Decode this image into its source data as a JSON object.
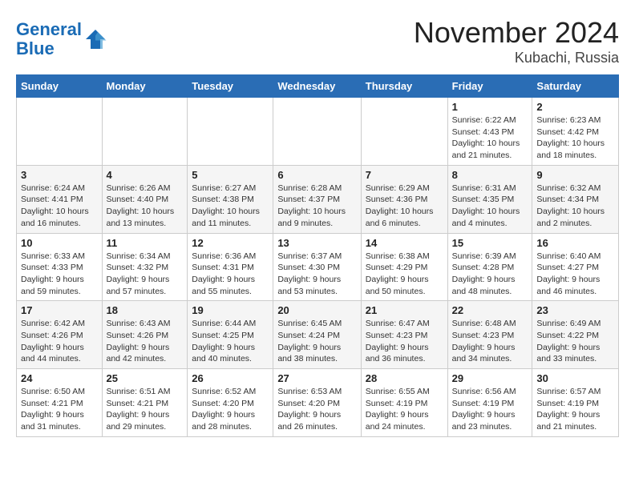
{
  "header": {
    "logo_line1": "General",
    "logo_line2": "Blue",
    "month": "November 2024",
    "location": "Kubachi, Russia"
  },
  "weekdays": [
    "Sunday",
    "Monday",
    "Tuesday",
    "Wednesday",
    "Thursday",
    "Friday",
    "Saturday"
  ],
  "weeks": [
    [
      {
        "day": "",
        "detail": ""
      },
      {
        "day": "",
        "detail": ""
      },
      {
        "day": "",
        "detail": ""
      },
      {
        "day": "",
        "detail": ""
      },
      {
        "day": "",
        "detail": ""
      },
      {
        "day": "1",
        "detail": "Sunrise: 6:22 AM\nSunset: 4:43 PM\nDaylight: 10 hours\nand 21 minutes."
      },
      {
        "day": "2",
        "detail": "Sunrise: 6:23 AM\nSunset: 4:42 PM\nDaylight: 10 hours\nand 18 minutes."
      }
    ],
    [
      {
        "day": "3",
        "detail": "Sunrise: 6:24 AM\nSunset: 4:41 PM\nDaylight: 10 hours\nand 16 minutes."
      },
      {
        "day": "4",
        "detail": "Sunrise: 6:26 AM\nSunset: 4:40 PM\nDaylight: 10 hours\nand 13 minutes."
      },
      {
        "day": "5",
        "detail": "Sunrise: 6:27 AM\nSunset: 4:38 PM\nDaylight: 10 hours\nand 11 minutes."
      },
      {
        "day": "6",
        "detail": "Sunrise: 6:28 AM\nSunset: 4:37 PM\nDaylight: 10 hours\nand 9 minutes."
      },
      {
        "day": "7",
        "detail": "Sunrise: 6:29 AM\nSunset: 4:36 PM\nDaylight: 10 hours\nand 6 minutes."
      },
      {
        "day": "8",
        "detail": "Sunrise: 6:31 AM\nSunset: 4:35 PM\nDaylight: 10 hours\nand 4 minutes."
      },
      {
        "day": "9",
        "detail": "Sunrise: 6:32 AM\nSunset: 4:34 PM\nDaylight: 10 hours\nand 2 minutes."
      }
    ],
    [
      {
        "day": "10",
        "detail": "Sunrise: 6:33 AM\nSunset: 4:33 PM\nDaylight: 9 hours\nand 59 minutes."
      },
      {
        "day": "11",
        "detail": "Sunrise: 6:34 AM\nSunset: 4:32 PM\nDaylight: 9 hours\nand 57 minutes."
      },
      {
        "day": "12",
        "detail": "Sunrise: 6:36 AM\nSunset: 4:31 PM\nDaylight: 9 hours\nand 55 minutes."
      },
      {
        "day": "13",
        "detail": "Sunrise: 6:37 AM\nSunset: 4:30 PM\nDaylight: 9 hours\nand 53 minutes."
      },
      {
        "day": "14",
        "detail": "Sunrise: 6:38 AM\nSunset: 4:29 PM\nDaylight: 9 hours\nand 50 minutes."
      },
      {
        "day": "15",
        "detail": "Sunrise: 6:39 AM\nSunset: 4:28 PM\nDaylight: 9 hours\nand 48 minutes."
      },
      {
        "day": "16",
        "detail": "Sunrise: 6:40 AM\nSunset: 4:27 PM\nDaylight: 9 hours\nand 46 minutes."
      }
    ],
    [
      {
        "day": "17",
        "detail": "Sunrise: 6:42 AM\nSunset: 4:26 PM\nDaylight: 9 hours\nand 44 minutes."
      },
      {
        "day": "18",
        "detail": "Sunrise: 6:43 AM\nSunset: 4:26 PM\nDaylight: 9 hours\nand 42 minutes."
      },
      {
        "day": "19",
        "detail": "Sunrise: 6:44 AM\nSunset: 4:25 PM\nDaylight: 9 hours\nand 40 minutes."
      },
      {
        "day": "20",
        "detail": "Sunrise: 6:45 AM\nSunset: 4:24 PM\nDaylight: 9 hours\nand 38 minutes."
      },
      {
        "day": "21",
        "detail": "Sunrise: 6:47 AM\nSunset: 4:23 PM\nDaylight: 9 hours\nand 36 minutes."
      },
      {
        "day": "22",
        "detail": "Sunrise: 6:48 AM\nSunset: 4:23 PM\nDaylight: 9 hours\nand 34 minutes."
      },
      {
        "day": "23",
        "detail": "Sunrise: 6:49 AM\nSunset: 4:22 PM\nDaylight: 9 hours\nand 33 minutes."
      }
    ],
    [
      {
        "day": "24",
        "detail": "Sunrise: 6:50 AM\nSunset: 4:21 PM\nDaylight: 9 hours\nand 31 minutes."
      },
      {
        "day": "25",
        "detail": "Sunrise: 6:51 AM\nSunset: 4:21 PM\nDaylight: 9 hours\nand 29 minutes."
      },
      {
        "day": "26",
        "detail": "Sunrise: 6:52 AM\nSunset: 4:20 PM\nDaylight: 9 hours\nand 28 minutes."
      },
      {
        "day": "27",
        "detail": "Sunrise: 6:53 AM\nSunset: 4:20 PM\nDaylight: 9 hours\nand 26 minutes."
      },
      {
        "day": "28",
        "detail": "Sunrise: 6:55 AM\nSunset: 4:19 PM\nDaylight: 9 hours\nand 24 minutes."
      },
      {
        "day": "29",
        "detail": "Sunrise: 6:56 AM\nSunset: 4:19 PM\nDaylight: 9 hours\nand 23 minutes."
      },
      {
        "day": "30",
        "detail": "Sunrise: 6:57 AM\nSunset: 4:19 PM\nDaylight: 9 hours\nand 21 minutes."
      }
    ]
  ]
}
